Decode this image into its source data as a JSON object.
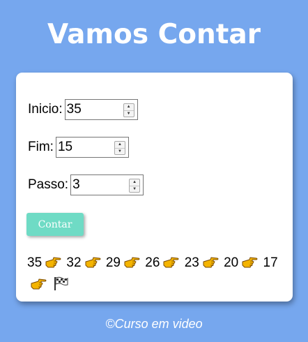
{
  "header": {
    "title": "Vamos Contar"
  },
  "form": {
    "inicio": {
      "label": "Inicio:",
      "value": "35"
    },
    "fim": {
      "label": "Fim:",
      "value": "15"
    },
    "passo": {
      "label": "Passo:",
      "value": "3"
    },
    "button_label": "Contar"
  },
  "result": {
    "steps": [
      "35",
      "32",
      "29",
      "26",
      "23",
      "20",
      "17"
    ],
    "separator_icon": "pointing-hand-icon",
    "end_icon": "checkered-flag-icon"
  },
  "footer": {
    "text": "©Curso em video"
  },
  "colors": {
    "background": "#76a7ee",
    "card": "#ffffff",
    "button": "#6fdbc5",
    "hand": "#f4b400"
  }
}
